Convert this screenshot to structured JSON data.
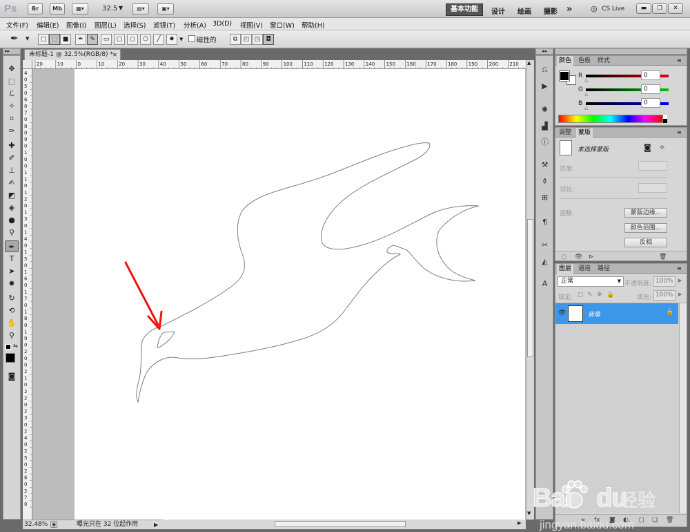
{
  "app": {
    "logo": "Ps",
    "br_label": "Br",
    "mb_label": "Mb",
    "zoom_value": "32.5",
    "workspaces": [
      "基本功能",
      "设计",
      "绘画",
      "摄影"
    ],
    "more": "»",
    "cs_live": "CS Live"
  },
  "menu": [
    "文件(F)",
    "编辑(E)",
    "图像(I)",
    "图层(L)",
    "选择(S)",
    "滤镜(T)",
    "分析(A)",
    "3D(D)",
    "视图(V)",
    "窗口(W)",
    "帮助(H)"
  ],
  "options": {
    "magnetic_label": "磁性的"
  },
  "document": {
    "tab_title": "未标题-1 @ 32.5%(RGB/8) *",
    "close": "✕",
    "ruler_h": [
      "20",
      "10",
      "0",
      "10",
      "20",
      "30",
      "40",
      "50",
      "60",
      "70",
      "80",
      "90",
      "100",
      "110",
      "120",
      "130",
      "140",
      "150",
      "160",
      "170",
      "180",
      "190",
      "200",
      "210"
    ],
    "ruler_v": [
      "4",
      "0",
      "5",
      "0",
      "6",
      "0",
      "7",
      "0",
      "8",
      "0",
      "9",
      "0",
      "1",
      "0",
      "0",
      "1",
      "1",
      "0",
      "1",
      "2",
      "0",
      "1",
      "3",
      "0",
      "1",
      "4",
      "0",
      "1",
      "5",
      "0",
      "1",
      "6",
      "0",
      "1",
      "7",
      "0",
      "1",
      "8",
      "0",
      "1",
      "9",
      "0",
      "2",
      "0",
      "0",
      "2",
      "1",
      "0",
      "2",
      "2",
      "0",
      "2",
      "3",
      "0",
      "2",
      "4",
      "0",
      "2",
      "5",
      "0",
      "2",
      "6",
      "0",
      "2",
      "7",
      "0"
    ]
  },
  "status": {
    "zoom": "32.48%",
    "message": "曝光只在 32 位起作用",
    "arrow": "▶"
  },
  "color_panel": {
    "tabs": [
      "颜色",
      "色板",
      "样式"
    ],
    "channels": [
      {
        "label": "R",
        "value": "0",
        "color": "#d90000"
      },
      {
        "label": "G",
        "value": "0",
        "color": "#00b000"
      },
      {
        "label": "B",
        "value": "0",
        "color": "#0000d0"
      }
    ]
  },
  "mask_panel": {
    "tabs": [
      "调整",
      "蒙版"
    ],
    "no_mask": "未选择蒙版",
    "density": "浓度:",
    "feather": "羽化:",
    "refine": "调整:",
    "buttons": [
      "蒙版边缘...",
      "颜色范围...",
      "反相"
    ]
  },
  "layers_panel": {
    "tabs": [
      "图层",
      "通道",
      "路径"
    ],
    "blend_mode": "正常",
    "opacity_label": "不透明度:",
    "opacity_value": "100%",
    "lock_label": "锁定:",
    "fill_label": "填充:",
    "fill_value": "100%",
    "layer_name": "背景",
    "footer_icons": [
      "∞",
      "fx.",
      "◙",
      "◐.",
      "▢",
      "❏",
      "🗑"
    ],
    "highlight_color": "#3d97e8"
  },
  "watermark": {
    "brand": "Bai",
    "brand2": "du",
    "cn": "经验",
    "url": "jingyan.baidu.com"
  },
  "annotation": {
    "arrow_color": "#ee1111"
  }
}
